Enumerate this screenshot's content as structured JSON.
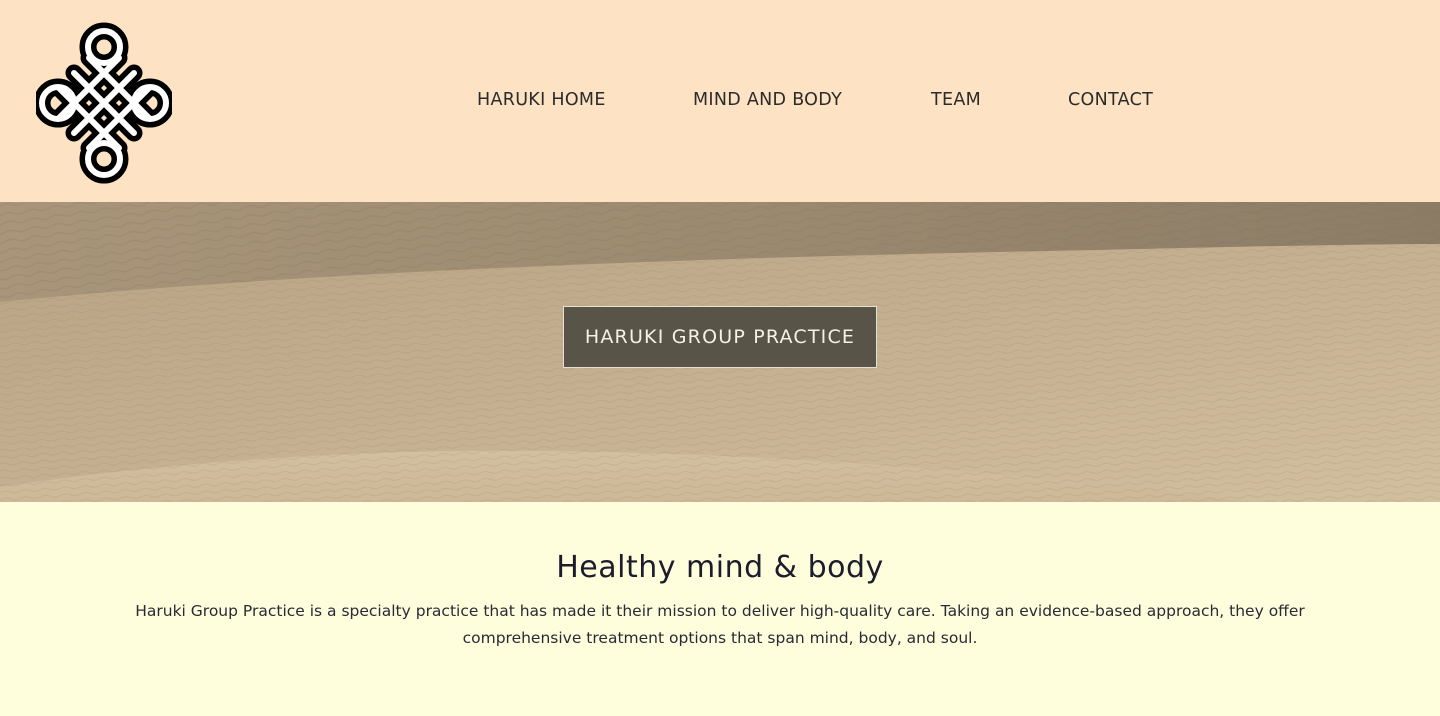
{
  "logo": {
    "icon": "endless-knot-icon"
  },
  "nav": {
    "items": [
      {
        "label": "HARUKI HOME"
      },
      {
        "label": "MIND AND BODY"
      },
      {
        "label": "TEAM"
      },
      {
        "label": "CONTACT"
      }
    ]
  },
  "hero": {
    "button_label": "HARUKI GROUP PRACTICE",
    "background": "sand-dunes-image"
  },
  "intro": {
    "heading": "Healthy mind & body",
    "body": "Haruki Group Practice is a specialty practice that has made it their mission to deliver high-quality care. Taking an evidence-based approach, they offer comprehensive treatment options that span mind, body, and soul."
  },
  "colors": {
    "header_bg": "#fde3c3",
    "content_bg": "#fffedc",
    "button_bg": "#585548"
  }
}
